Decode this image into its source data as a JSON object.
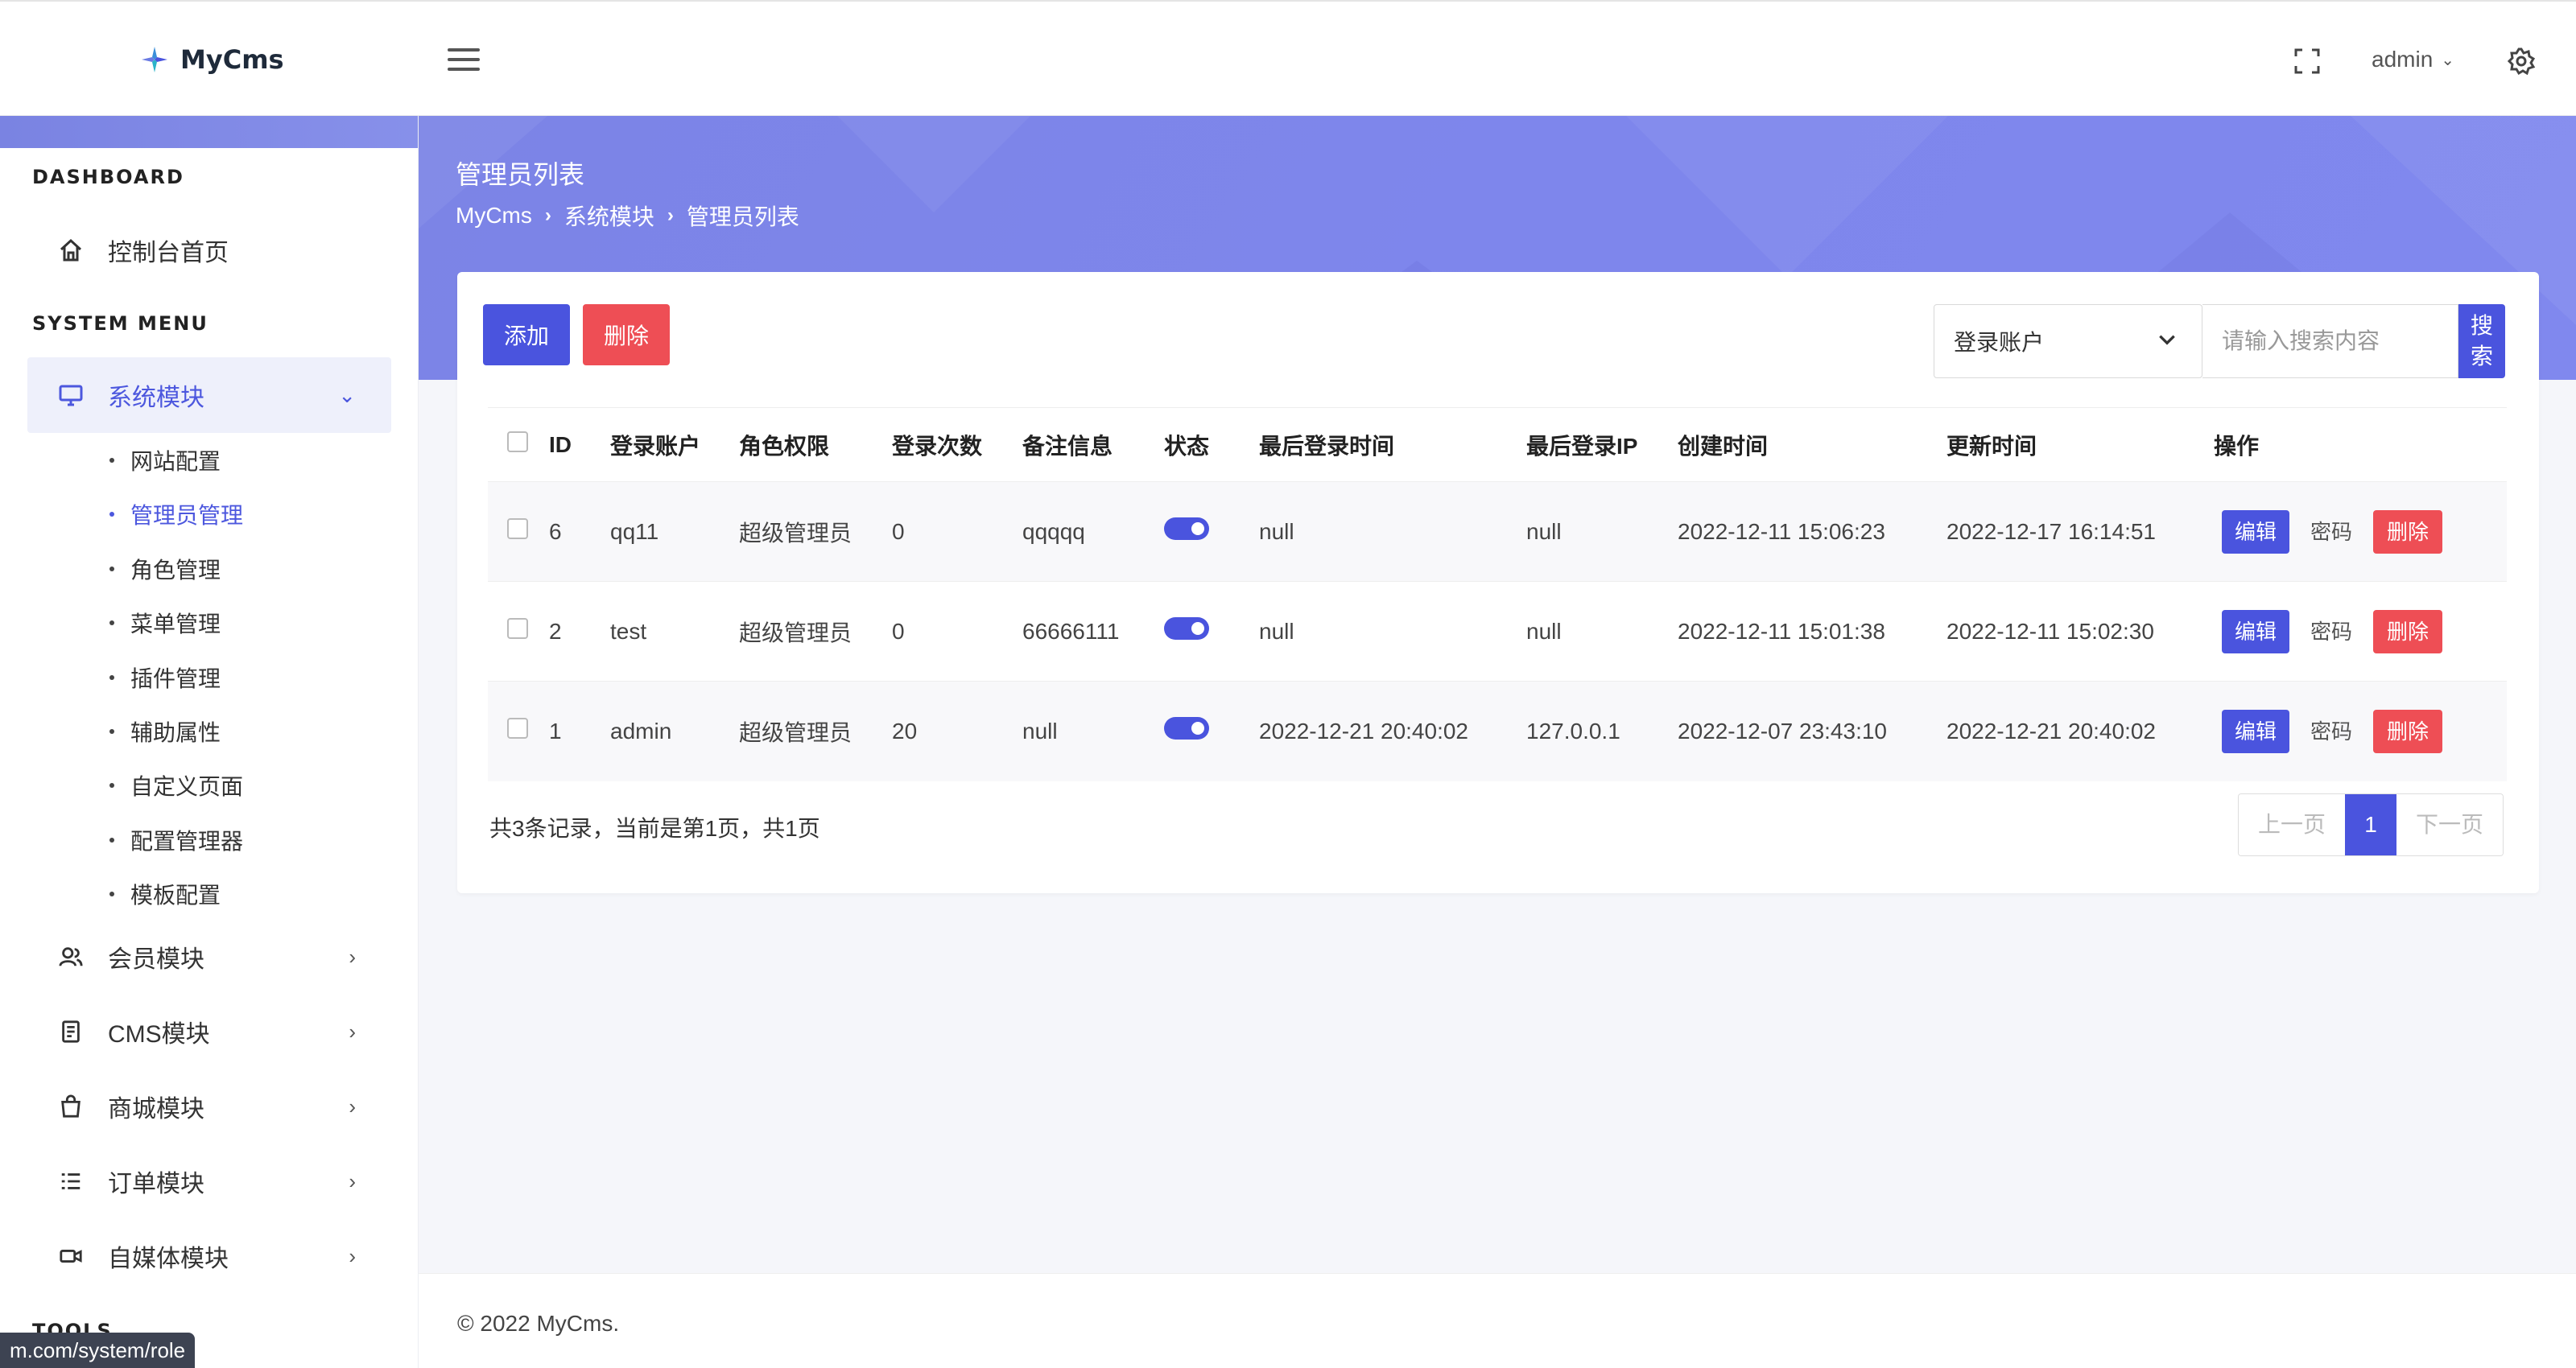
{
  "app": {
    "name": "MyCms",
    "user": "admin"
  },
  "sidebar": {
    "section_dashboard": "DASHBOARD",
    "section_system": "SYSTEM MENU",
    "section_tools": "TOOLS",
    "dashboard_item": "控制台首页",
    "items": [
      {
        "label": "系统模块",
        "icon": "monitor-icon",
        "active": true
      },
      {
        "label": "会员模块",
        "icon": "users-icon"
      },
      {
        "label": "CMS模块",
        "icon": "document-icon"
      },
      {
        "label": "商城模块",
        "icon": "shopping-bag-icon"
      },
      {
        "label": "订单模块",
        "icon": "list-icon"
      },
      {
        "label": "自媒体模块",
        "icon": "video-icon"
      }
    ],
    "sub_items": [
      "网站配置",
      "管理员管理",
      "角色管理",
      "菜单管理",
      "插件管理",
      "辅助属性",
      "自定义页面",
      "配置管理器",
      "模板配置"
    ]
  },
  "page": {
    "title": "管理员列表",
    "breadcrumb": [
      "MyCms",
      "系统模块",
      "管理员列表"
    ]
  },
  "toolbar": {
    "add_label": "添加",
    "delete_label": "删除",
    "select_value": "登录账户",
    "search_placeholder": "请输入搜索内容",
    "search_label": "搜索"
  },
  "table": {
    "headers": [
      "ID",
      "登录账户",
      "角色权限",
      "登录次数",
      "备注信息",
      "状态",
      "最后登录时间",
      "最后登录IP",
      "创建时间",
      "更新时间",
      "操作"
    ],
    "rows": [
      {
        "id": "6",
        "account": "qq11",
        "role": "超级管理员",
        "logins": "0",
        "note": "qqqqq",
        "status": true,
        "last_login": "null",
        "last_ip": "null",
        "created": "2022-12-11 15:06:23",
        "updated": "2022-12-17 16:14:51"
      },
      {
        "id": "2",
        "account": "test",
        "role": "超级管理员",
        "logins": "0",
        "note": "66666111",
        "status": true,
        "last_login": "null",
        "last_ip": "null",
        "created": "2022-12-11 15:01:38",
        "updated": "2022-12-11 15:02:30"
      },
      {
        "id": "1",
        "account": "admin",
        "role": "超级管理员",
        "logins": "20",
        "note": "null",
        "status": true,
        "last_login": "2022-12-21 20:40:02",
        "last_ip": "127.0.0.1",
        "created": "2022-12-07 23:43:10",
        "updated": "2022-12-21 20:40:02"
      }
    ],
    "ops": {
      "edit": "编辑",
      "password": "密码",
      "delete": "删除"
    }
  },
  "pagination": {
    "summary": "共3条记录，当前是第1页，共1页",
    "prev": "上一页",
    "current": "1",
    "next": "下一页"
  },
  "footer": "© 2022 MyCms.",
  "status_url": "m.com/system/role",
  "colors": {
    "primary": "#4a54de",
    "danger": "#ee4e55",
    "hero": "#7c84e6"
  }
}
